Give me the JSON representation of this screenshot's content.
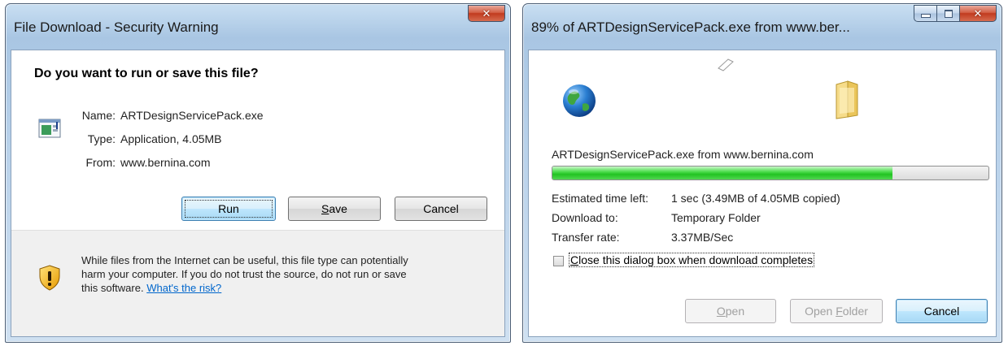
{
  "security_dialog": {
    "title": "File Download - Security Warning",
    "heading": "Do you want to run or save this file?",
    "name_label": "Name:",
    "name_value": "ARTDesignServicePack.exe",
    "type_label": "Type:",
    "type_value": "Application, 4.05MB",
    "from_label": "From:",
    "from_value": "www.bernina.com",
    "run_button": "Run",
    "save_button_prefix": "",
    "save_button_access": "S",
    "save_button_rest": "ave",
    "cancel_button": "Cancel",
    "warning_text": "While files from the Internet can be useful, this file type can potentially harm your computer. If you do not trust the source, do not run or save this software.",
    "risk_link": "What's the risk?"
  },
  "progress_dialog": {
    "title": "89% of ARTDesignServicePack.exe from www.ber...",
    "file_line": "ARTDesignServicePack.exe from www.bernina.com",
    "progress_fraction": 0.78,
    "time_label": "Estimated time left:",
    "time_value": "1 sec (3.49MB of 4.05MB copied)",
    "download_to_label": "Download to:",
    "download_to_value": "Temporary Folder",
    "rate_label": "Transfer rate:",
    "rate_value": "3.37MB/Sec",
    "close_checkbox_access": "C",
    "close_checkbox_rest": "lose this dialog box when download completes",
    "close_checkbox_checked": false,
    "open_button_access": "O",
    "open_button_rest": "pen",
    "open_folder_prefix": "Open ",
    "open_folder_access": "F",
    "open_folder_rest": "older",
    "cancel_button": "Cancel"
  },
  "icons": {
    "close": "close-icon",
    "minimize": "minimize-icon",
    "maximize": "maximize-icon",
    "app": "application-icon",
    "shield": "shield-warning-icon",
    "globe": "globe-icon",
    "folder": "folder-icon",
    "paper": "flying-document-icon"
  }
}
